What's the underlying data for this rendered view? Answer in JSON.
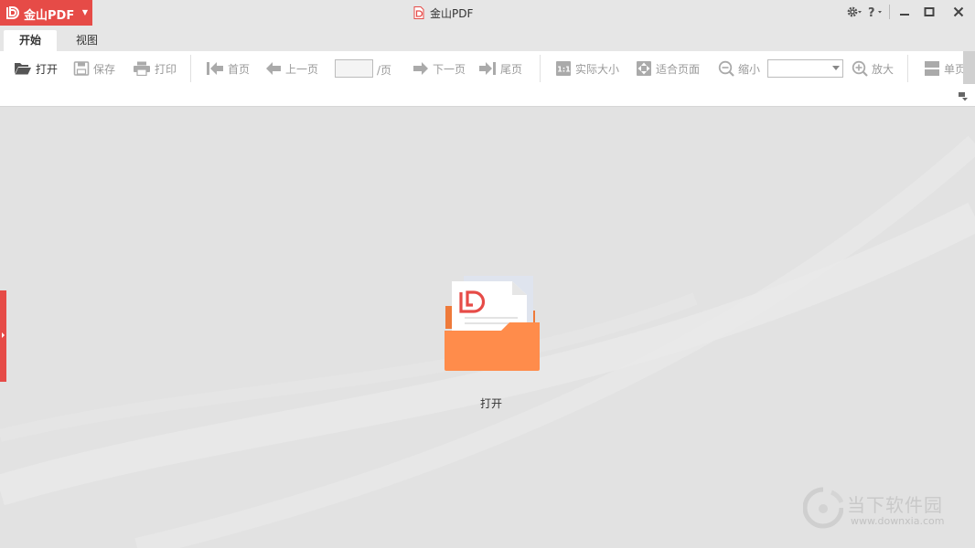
{
  "app": {
    "brand_name": "金山PDF",
    "window_title": "金山PDF"
  },
  "tabs": [
    {
      "label": "开始",
      "active": true
    },
    {
      "label": "视图",
      "active": false
    }
  ],
  "toolbar": {
    "open": "打开",
    "save": "保存",
    "print": "打印",
    "first_page": "首页",
    "prev_page": "上一页",
    "page_input_value": "",
    "page_separator": "/页",
    "next_page": "下一页",
    "last_page": "尾页",
    "actual_size": "实际大小",
    "fit_page": "适合页面",
    "zoom_out": "缩小",
    "zoom_value": "",
    "zoom_in": "放大",
    "single_page": "单页"
  },
  "main": {
    "open_label": "打开"
  },
  "watermark": {
    "name": "当下软件园",
    "url": "www.downxia.com"
  },
  "colors": {
    "brand_red": "#e64b47",
    "folder_orange": "#ff8c4b",
    "background": "#e2e2e2"
  },
  "icons": [
    "pdf-logo-icon",
    "gear-icon",
    "help-icon",
    "minimize-icon",
    "maximize-icon",
    "close-icon",
    "folder-open-icon",
    "save-icon",
    "print-icon",
    "first-page-icon",
    "prev-page-icon",
    "next-page-icon",
    "last-page-icon",
    "actual-size-icon",
    "fit-page-icon",
    "zoom-out-icon",
    "zoom-in-icon",
    "single-page-icon"
  ]
}
